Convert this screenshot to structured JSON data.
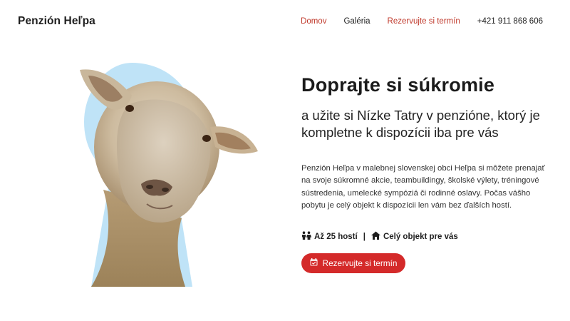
{
  "brand": {
    "name": "Penzión Heľpa"
  },
  "nav": {
    "items": [
      {
        "label": "Domov",
        "color": "#c0392b"
      },
      {
        "label": "Galéria",
        "color": "#222222"
      },
      {
        "label": "Rezervujte si termín",
        "color": "#c0392b"
      },
      {
        "label": "+421 911 868 606",
        "color": "#222222"
      }
    ]
  },
  "hero": {
    "title": "Doprajte si súkromie",
    "subtitle": "a užite si Nízke Tatry v penzióne, ktorý je kompletne k dispozícii iba pre vás",
    "description": "Penzión Heľpa v malebnej slovenskej obci Heľpa si môžete prenajať na svoje súkromné akcie, teambuildingy, školské výlety, tréningové sústredenia, umelecké sympóziá či rodinné oslavy. Počas vášho pobytu je celý objekt k dispozícii len vám bez ďalších hostí.",
    "features": [
      {
        "icon": "people-icon",
        "label": "Až 25 hostí"
      },
      {
        "icon": "home-icon",
        "label": "Celý objekt pre vás"
      }
    ],
    "separator": "|",
    "cta": {
      "label": "Rezervujte si termín",
      "icon": "calendar-icon"
    }
  },
  "colors": {
    "accent": "#d42a2a",
    "nav_accent": "#c0392b",
    "keyhole_blue": "#bfe3f7"
  }
}
